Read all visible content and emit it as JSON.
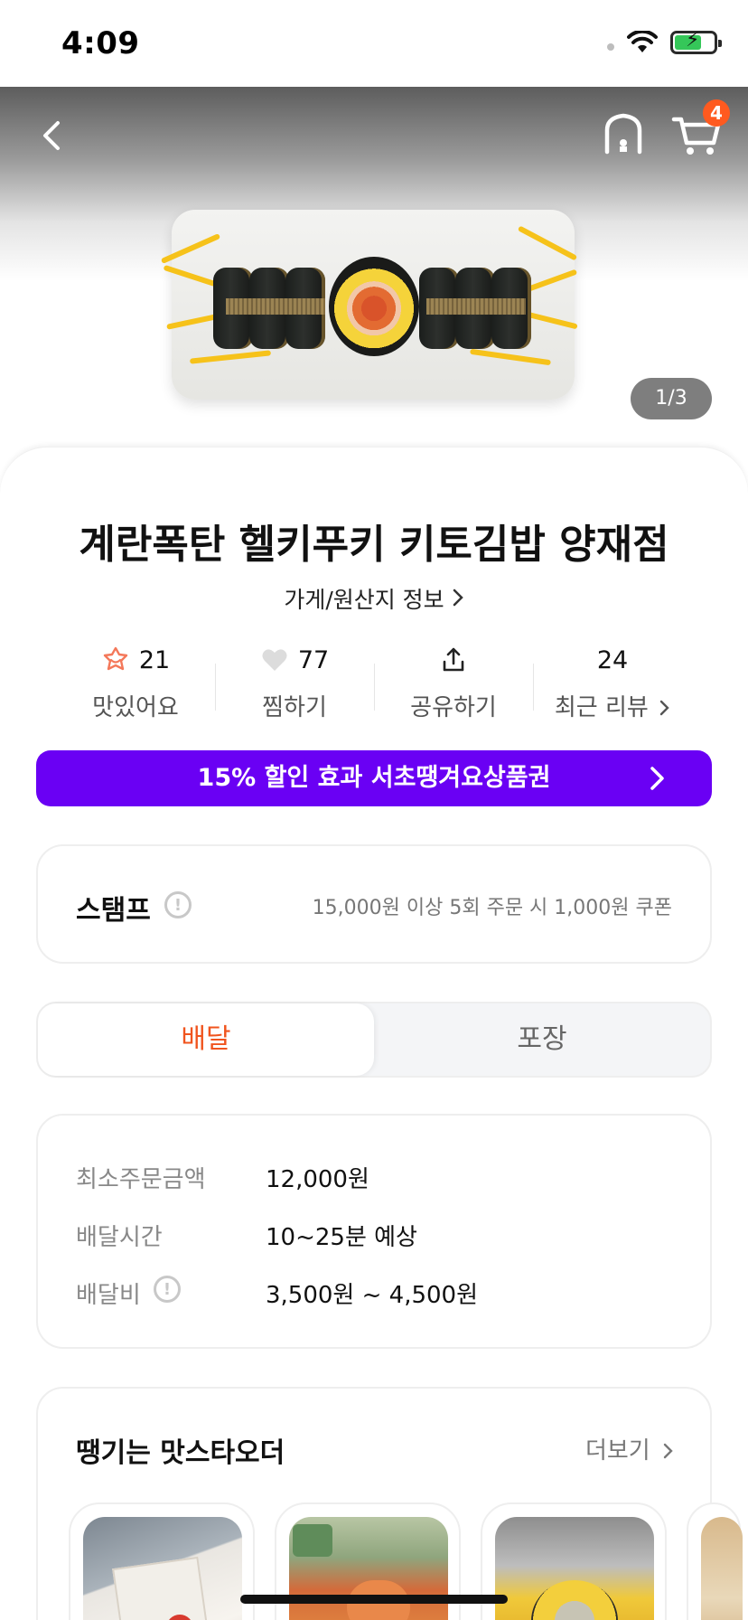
{
  "status_bar": {
    "time": "4:09"
  },
  "header": {
    "cart_count": "4"
  },
  "gallery": {
    "page_indicator": "1/3"
  },
  "store": {
    "name": "계란폭탄 헬키푸키 키토김밥 양재점",
    "info_link": "가게/원산지 정보"
  },
  "stats": [
    {
      "value": "21",
      "label": "맛있어요",
      "icon": "tasty-badge-icon"
    },
    {
      "value": "77",
      "label": "찜하기",
      "icon": "heart-icon"
    },
    {
      "value": "",
      "label": "공유하기",
      "icon": "share-icon"
    },
    {
      "value": "24",
      "label": "최근 리뷰",
      "icon": ""
    }
  ],
  "promo": {
    "text": "15% 할인 효과 서초땡겨요상품권"
  },
  "stamp": {
    "title": "스탬프",
    "description": "15,000원 이상 5회 주문 시 1,000원 쿠폰"
  },
  "order_tabs": {
    "active": "배달",
    "inactive": "포장"
  },
  "delivery_info": {
    "rows": [
      {
        "label": "최소주문금액",
        "value": "12,000원"
      },
      {
        "label": "배달시간",
        "value": "10~25분 예상"
      },
      {
        "label": "배달비",
        "value": "3,500원 ~ 4,500원"
      }
    ]
  },
  "recommend": {
    "title": "땡기는 맛스타오더",
    "more": "더보기"
  },
  "colors": {
    "accent_orange": "#f0541e",
    "promo_purple": "#6a00f4",
    "badge_orange": "#ff5a1f"
  }
}
